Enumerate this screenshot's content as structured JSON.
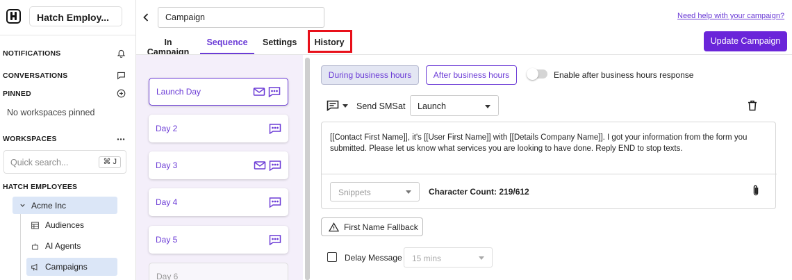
{
  "sidebar": {
    "workspace_name": "Hatch Employ...",
    "sections": {
      "notifications": "NOTIFICATIONS",
      "conversations": "CONVERSATIONS",
      "pinned": "PINNED",
      "workspaces": "WORKSPACES",
      "hatch_employees": "HATCH EMPLOYEES"
    },
    "no_pinned": "No workspaces pinned",
    "quick_search_placeholder": "Quick search...",
    "quick_search_shortcut": "⌘ J",
    "tree": {
      "org": "Acme Inc",
      "items": [
        "Audiences",
        "AI Agents",
        "Campaigns"
      ]
    }
  },
  "header": {
    "campaign_name": "Campaign",
    "help_link": "Need help with your campaign?",
    "update_button": "Update Campaign"
  },
  "tabs": [
    "In Campaign",
    "Sequence",
    "Settings",
    "History"
  ],
  "active_tab": "Sequence",
  "days": [
    {
      "label": "Launch Day",
      "icons": [
        "mail-icon",
        "sms-icon"
      ]
    },
    {
      "label": "Day 2",
      "icons": [
        "sms-icon"
      ]
    },
    {
      "label": "Day 3",
      "icons": [
        "mail-icon",
        "sms-icon"
      ]
    },
    {
      "label": "Day 4",
      "icons": [
        "sms-icon"
      ]
    },
    {
      "label": "Day 5",
      "icons": [
        "sms-icon"
      ]
    },
    {
      "label": "Day 6",
      "icons": []
    }
  ],
  "editor": {
    "hours_during": "During business hours",
    "hours_after": "After business hours",
    "toggle_label": "Enable after business hours response",
    "send_label": "Send SMS",
    "at_label": "at",
    "send_time": "Launch",
    "message": "[[Contact First Name]], it's [[User First Name]] with [[Details Company Name]]. I got your information from the form you submitted. Please let us know what services you are looking to have done. Reply END to stop texts.",
    "snippets_placeholder": "Snippets",
    "char_count": "Character Count: 219/612",
    "fallback_button": "First Name Fallback",
    "delay_label": "Delay Message",
    "delay_value": "15 mins"
  },
  "colors": {
    "accent": "#6b3bd6",
    "primary_button": "#6a25d9",
    "highlight_box": "#e8101a",
    "day_panel_bg": "#f4effa",
    "selected_nav": "#dbe6f7"
  }
}
